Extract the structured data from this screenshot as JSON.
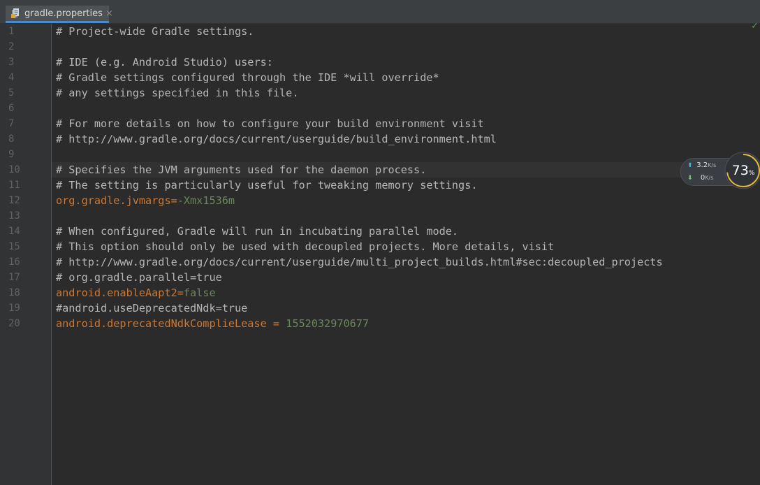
{
  "tab": {
    "filename": "gradle.properties",
    "close_glyph": "×"
  },
  "editor": {
    "status_check": "✓",
    "lines": [
      {
        "number": "1",
        "type": "comment",
        "text": "# Project-wide Gradle settings."
      },
      {
        "number": "2",
        "type": "blank",
        "text": ""
      },
      {
        "number": "3",
        "type": "comment",
        "text": "# IDE (e.g. Android Studio) users:"
      },
      {
        "number": "4",
        "type": "comment",
        "text": "# Gradle settings configured through the IDE *will override*"
      },
      {
        "number": "5",
        "type": "comment",
        "text": "# any settings specified in this file."
      },
      {
        "number": "6",
        "type": "blank",
        "text": ""
      },
      {
        "number": "7",
        "type": "comment",
        "text": "# For more details on how to configure your build environment visit"
      },
      {
        "number": "8",
        "type": "comment",
        "text": "# http://www.gradle.org/docs/current/userguide/build_environment.html"
      },
      {
        "number": "9",
        "type": "blank",
        "text": ""
      },
      {
        "number": "10",
        "type": "comment",
        "text": "# Specifies the JVM arguments used for the daemon process."
      },
      {
        "number": "11",
        "type": "comment",
        "text": "# The setting is particularly useful for tweaking memory settings."
      },
      {
        "number": "12",
        "type": "property",
        "key": "org.gradle.jvmargs",
        "sep": "=",
        "value": "-Xmx1536m"
      },
      {
        "number": "13",
        "type": "blank",
        "text": ""
      },
      {
        "number": "14",
        "type": "comment",
        "text": "# When configured, Gradle will run in incubating parallel mode."
      },
      {
        "number": "15",
        "type": "comment",
        "text": "# This option should only be used with decoupled projects. More details, visit"
      },
      {
        "number": "16",
        "type": "comment",
        "text": "# http://www.gradle.org/docs/current/userguide/multi_project_builds.html#sec:decoupled_projects"
      },
      {
        "number": "17",
        "type": "comment",
        "text": "# org.gradle.parallel=true"
      },
      {
        "number": "18",
        "type": "property",
        "key": "android.enableAapt2",
        "sep": "=",
        "value": "false"
      },
      {
        "number": "19",
        "type": "comment",
        "text": "#android.useDeprecatedNdk=true"
      },
      {
        "number": "20",
        "type": "property",
        "key": "android.deprecatedNdkComplieLease",
        "sep": " = ",
        "value": "1552032970677"
      }
    ]
  },
  "net_monitor": {
    "upload_arrow": "⬆",
    "upload_value": "3.2",
    "upload_unit": "K/s",
    "download_arrow": "⬇",
    "download_value": "0",
    "download_unit": "K/s",
    "percent_value": "73",
    "percent_sign": "%",
    "percent": 73
  },
  "colors": {
    "background": "#2b2b2b",
    "comment": "#b6b6b6",
    "key": "#cc7832",
    "value": "#6a8759",
    "line_number": "#606366",
    "tab_underline": "#4a88c7"
  }
}
